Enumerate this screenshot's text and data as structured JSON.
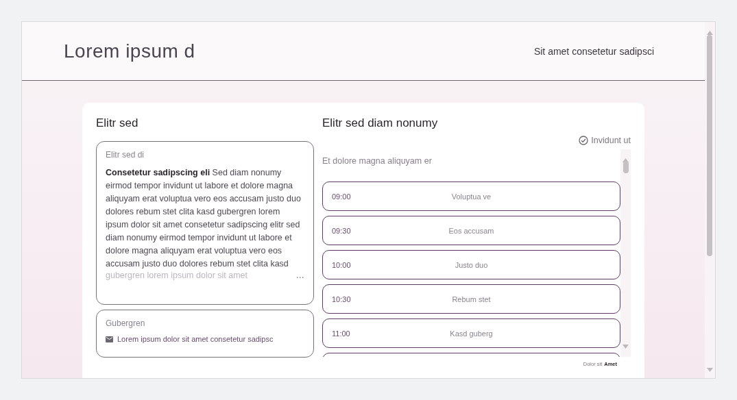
{
  "header": {
    "title": "Lorem ipsum d",
    "link": "Sit amet consetetur sadipsci"
  },
  "left": {
    "title": "Elitr sed",
    "description_card": {
      "label": "Elitr sed di",
      "text": "**Consetetur sadipscing eli** Sed diam nonumy eirmod tempor invidunt ut labore et dolore magna aliquyam erat voluptua vero eos accusam justo duo dolores rebum stet clita kasd gubergren lorem ipsum dolor sit amet consetetur sadipscing elitr sed diam nonumy eirmod tempor invidunt ut labore et dolore magna aliquyam erat voluptua vero eos accusam justo duo dolores rebum stet clita kasd",
      "faded_line": "gubergren lorem ipsum dolor sit amet",
      "more": "…"
    },
    "contact_card": {
      "label": "Gubergren",
      "email": "Lorem ipsum dolor sit amet consetetur sadipsc"
    }
  },
  "right": {
    "title": "Elitr sed diam nonumy",
    "status": "Invidunt ut",
    "subtitle": "Et dolore magna aliquyam er",
    "slots": [
      {
        "time": "09:00",
        "name": "Voluptua ve"
      },
      {
        "time": "09:30",
        "name": "Eos accusam"
      },
      {
        "time": "10:00",
        "name": "Justo duo"
      },
      {
        "time": "10:30",
        "name": "Rebum stet"
      },
      {
        "time": "11:00",
        "name": "Kasd guberg"
      }
    ],
    "footer": {
      "text": "Dolor sit",
      "brand": "Amet"
    }
  }
}
